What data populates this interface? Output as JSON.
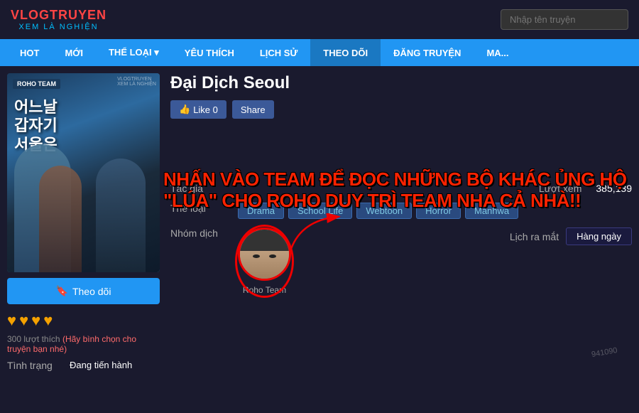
{
  "header": {
    "logo_top": "VLOGTRUYEN",
    "logo_bottom": "XEM LÀ NGHIỆN",
    "search_placeholder": "Nhập tên truyện"
  },
  "navbar": {
    "items": [
      {
        "label": "HOT",
        "id": "hot"
      },
      {
        "label": "MỚI",
        "id": "moi"
      },
      {
        "label": "THỂ LOẠI ▾",
        "id": "the-loai"
      },
      {
        "label": "YÊU THÍCH",
        "id": "yeu-thich"
      },
      {
        "label": "LỊCH SỬ",
        "id": "lich-su"
      },
      {
        "label": "THEO DÕI",
        "id": "theo-doi"
      },
      {
        "label": "ĐĂNG TRUYỆN",
        "id": "dang-truyen"
      },
      {
        "label": "MA...",
        "id": "ma"
      }
    ]
  },
  "manga": {
    "title": "Đại Dịch Seoul",
    "cover_team": "ROHO TEAM",
    "cover_title_line1": "어느날",
    "cover_title_line2": "갑자기",
    "cover_title_line3": "서울은",
    "like_label": "Like 0",
    "share_label": "Share",
    "overlay_text": "NHẤN VÀO TEAM ĐỂ ĐỌC NHỮNG BỘ KHÁC ỦNG HỘ \"LÚA\" CHO ROHO DUY TRÌ TEAM NHA CẢ NHÀ!!",
    "author_label": "Tác giả",
    "author_value": "",
    "genre_label": "Thể loại",
    "genres": [
      "Drama",
      "School Life",
      "Webtoon",
      "Horror",
      "Manhwa"
    ],
    "translator_label": "Nhóm dịch",
    "translator_name": "Roho Team",
    "views_label": "Lượt xem",
    "views_value": "385,139",
    "release_label": "Lịch ra mắt",
    "release_value": "Hàng ngày",
    "follow_label": "Theo dõi",
    "stars": [
      "♥",
      "♥",
      "♥",
      "♥"
    ],
    "votes": "300 lượt thích",
    "vote_cta": "(Hãy bình chọn cho truyện bạn nhé)",
    "status_label": "Tình trạng",
    "status_value": "Đang tiến hành",
    "watermark": "941090"
  }
}
